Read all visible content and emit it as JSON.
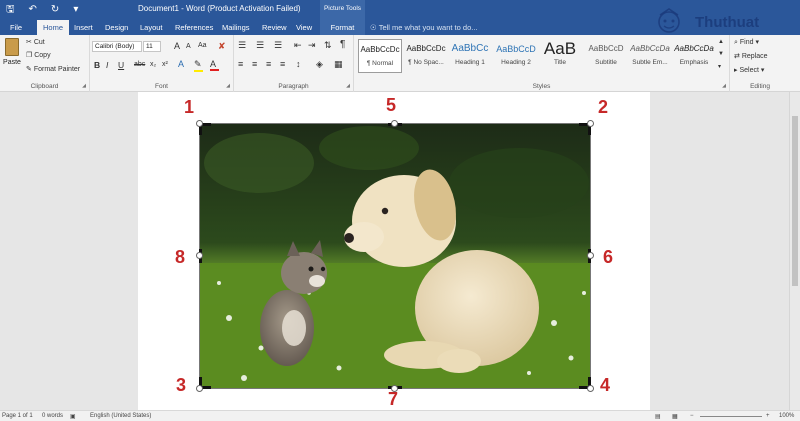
{
  "titlebar": {
    "title": "Document1 - Word (Product Activation Failed)",
    "context_group": "Picture Tools",
    "save_icon": "save-icon",
    "undo_icon": "undo-icon",
    "redo_icon": "redo-icon"
  },
  "tabs": {
    "file": "File",
    "home": "Home",
    "insert": "Insert",
    "design": "Design",
    "layout": "Layout",
    "references": "References",
    "mailings": "Mailings",
    "review": "Review",
    "view": "View",
    "format": "Format",
    "tellme": "Tell me what you want to do..."
  },
  "clipboard": {
    "paste": "Paste",
    "cut": "Cut",
    "copy": "Copy",
    "format_painter": "Format Painter",
    "label": "Clipboard"
  },
  "font": {
    "family": "Calibri (Body)",
    "size": "11",
    "grow": "A",
    "shrink": "A",
    "case": "Aa",
    "bold": "B",
    "italic": "I",
    "underline": "U",
    "strike": "abc",
    "subscript": "x₂",
    "superscript": "x²",
    "label": "Font"
  },
  "paragraph": {
    "label": "Paragraph",
    "pilcrow": "¶"
  },
  "styles": {
    "label": "Styles",
    "items": [
      {
        "sample": "AaBbCcDc",
        "name": "¶ Normal"
      },
      {
        "sample": "AaBbCcDc",
        "name": "¶ No Spac..."
      },
      {
        "sample": "AaBbCc",
        "name": "Heading 1"
      },
      {
        "sample": "AaBbCcD",
        "name": "Heading 2"
      },
      {
        "sample": "AaB",
        "name": "Title"
      },
      {
        "sample": "AaBbCcD",
        "name": "Subtitle"
      },
      {
        "sample": "AaBbCcDa",
        "name": "Subtle Em..."
      },
      {
        "sample": "AaBbCcDa",
        "name": "Emphasis"
      }
    ]
  },
  "editing": {
    "find": "Find",
    "replace": "Replace",
    "select": "Select",
    "label": "Editing"
  },
  "watermark": {
    "text": "Thuthuat"
  },
  "handles": {
    "n1": "1",
    "n2": "2",
    "n3": "3",
    "n4": "4",
    "n5": "5",
    "n6": "6",
    "n7": "7",
    "n8": "8"
  },
  "statusbar": {
    "page": "Page 1 of 1",
    "words": "0 words",
    "language": "English (United States)",
    "zoom": "100%"
  },
  "colors": {
    "title_blue": "#2b579a",
    "annotation_red": "#c62828"
  }
}
